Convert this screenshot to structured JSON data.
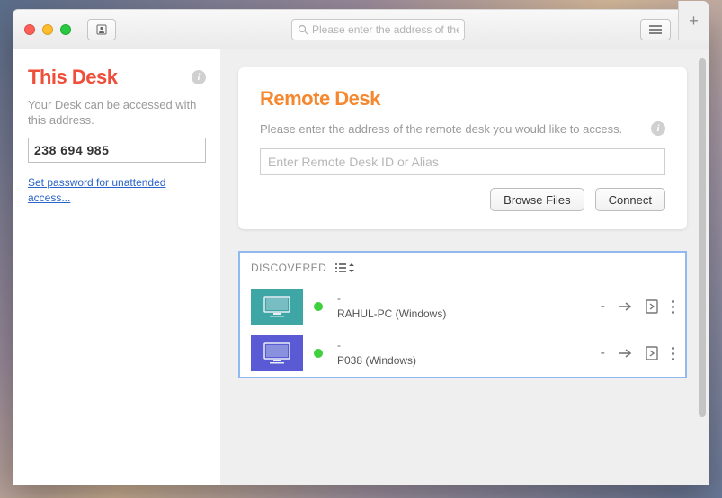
{
  "titlebar": {
    "search_placeholder": "Please enter the address of the remote desk you would like to access."
  },
  "sidebar": {
    "title": "This Desk",
    "desc": "Your Desk can be accessed with this address.",
    "address": "238 694 985",
    "set_password_link": "Set password for unattended access..."
  },
  "remote": {
    "title": "Remote Desk",
    "desc": "Please enter the address of the remote desk you would like to access.",
    "input_placeholder": "Enter Remote Desk ID or Alias",
    "browse_label": "Browse Files",
    "connect_label": "Connect"
  },
  "discovered": {
    "header": "DISCOVERED",
    "items": [
      {
        "alias": "-",
        "name": "RAHUL-PC (Windows)",
        "status_text": "-",
        "thumb": "teal"
      },
      {
        "alias": "-",
        "name": "P038 (Windows)",
        "status_text": "-",
        "thumb": "purple"
      }
    ]
  }
}
